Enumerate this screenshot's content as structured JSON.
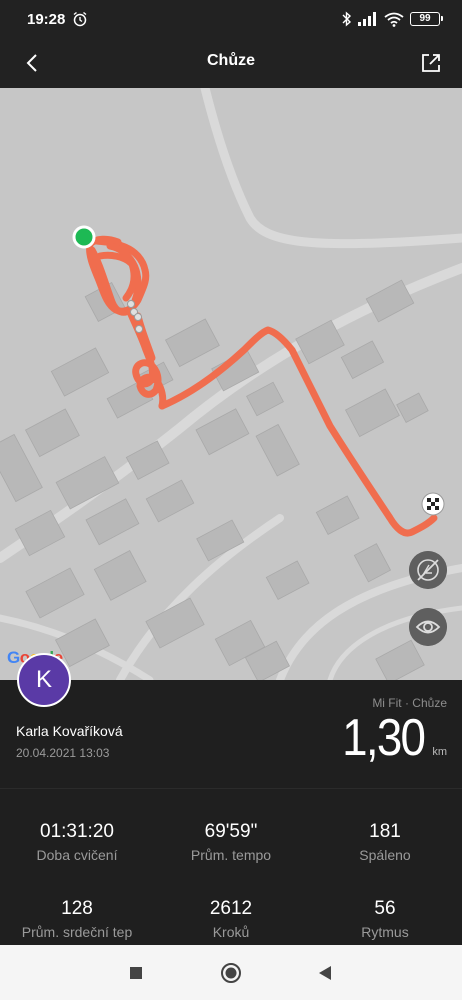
{
  "status_bar": {
    "time": "19:28",
    "battery": "99",
    "icons": [
      "alarm-icon",
      "bluetooth-icon",
      "signal-icon",
      "wifi-icon",
      "battery-icon"
    ]
  },
  "app_bar": {
    "title": "Chůze",
    "back_icon": "chevron-left-icon",
    "share_icon": "share-icon"
  },
  "map": {
    "route_color": "#f06d4e",
    "start_marker_color": "#1db954",
    "background": "#c6c6c6",
    "controls": [
      "map-layers-off-icon",
      "eye-icon"
    ],
    "attribution": "Google"
  },
  "summary": {
    "avatar_letter": "K",
    "avatar_color": "#5a3aa6",
    "user_name": "Karla Kovaříková",
    "date": "20.04.2021 13:03",
    "source": "Mi Fit · Chůze",
    "distance": "1,30",
    "distance_unit": "km"
  },
  "stats": [
    {
      "value": "01:31:20",
      "label": "Doba cvičení"
    },
    {
      "value": "69'59\"",
      "label": "Prům. tempo"
    },
    {
      "value": "181",
      "label": "Spáleno"
    },
    {
      "value": "128",
      "label": "Prům. srdeční tep"
    },
    {
      "value": "2612",
      "label": "Kroků"
    },
    {
      "value": "56",
      "label": "Rytmus"
    }
  ],
  "nav_bar": {
    "buttons": [
      "recents-square-icon",
      "home-circle-icon",
      "back-triangle-icon"
    ]
  }
}
